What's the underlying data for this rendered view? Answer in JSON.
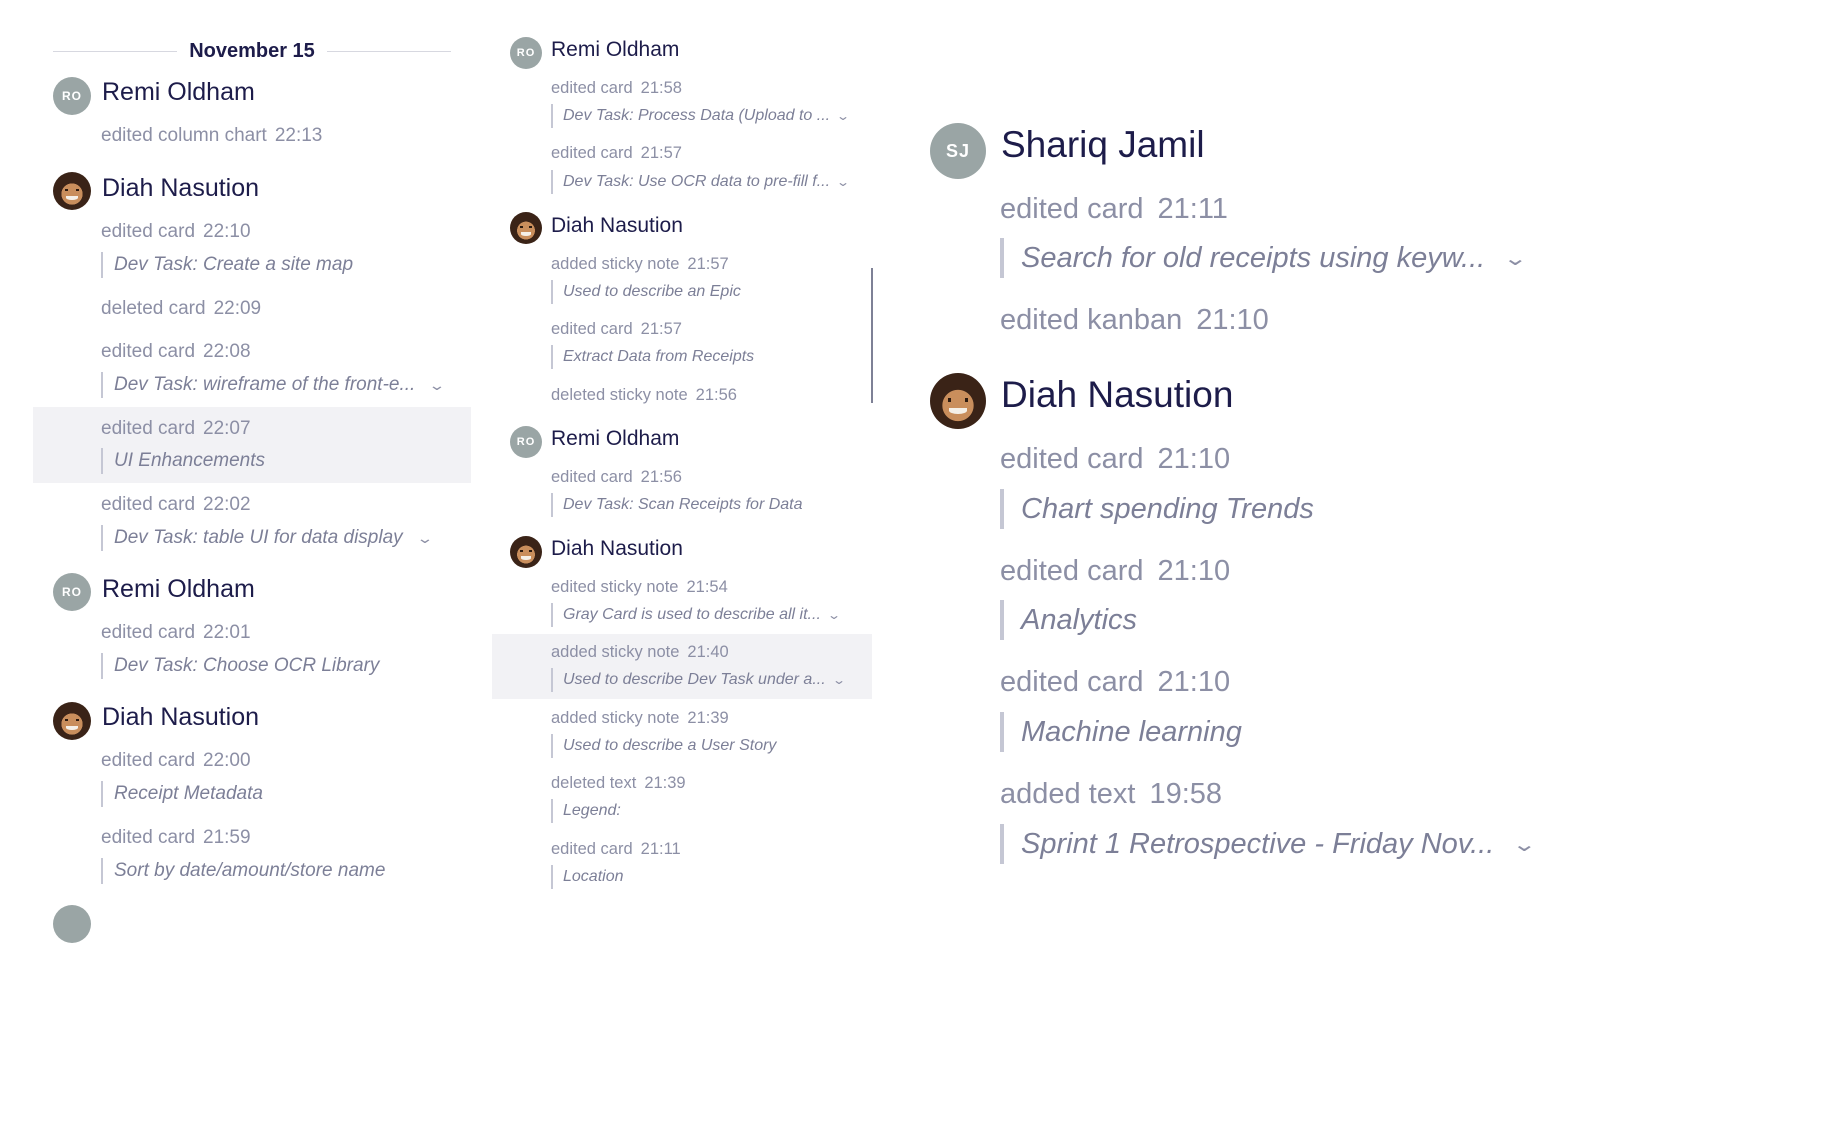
{
  "panel1": {
    "date_label": "November 15",
    "groups": [
      {
        "user": "Remi Oldham",
        "avatar": "RO",
        "entries": [
          {
            "action": "edited column chart",
            "time": "22:13"
          }
        ]
      },
      {
        "user": "Diah Nasution",
        "avatar": "photo",
        "entries": [
          {
            "action": "edited card",
            "time": "22:10",
            "quote": "Dev Task: Create a site map"
          },
          {
            "action": "deleted card",
            "time": "22:09"
          },
          {
            "action": "edited card",
            "time": "22:08",
            "quote": "Dev Task: wireframe of the front-e...",
            "expandable": true
          },
          {
            "action": "edited card",
            "time": "22:07",
            "quote": "UI Enhancements",
            "highlighted": true
          },
          {
            "action": "edited card",
            "time": "22:02",
            "quote": "Dev Task: table UI for data display",
            "expandable": true
          }
        ]
      },
      {
        "user": "Remi Oldham",
        "avatar": "RO",
        "entries": [
          {
            "action": "edited card",
            "time": "22:01",
            "quote": "Dev Task: Choose OCR Library"
          }
        ]
      },
      {
        "user": "Diah Nasution",
        "avatar": "photo",
        "entries": [
          {
            "action": "edited card",
            "time": "22:00",
            "quote": "Receipt Metadata"
          },
          {
            "action": "edited card",
            "time": "21:59",
            "quote": "Sort by date/amount/store name"
          }
        ]
      }
    ]
  },
  "panel2": {
    "groups": [
      {
        "user": "Remi Oldham",
        "avatar": "RO",
        "entries": [
          {
            "action": "edited card",
            "time": "21:58",
            "quote": "Dev Task: Process Data (Upload to ...",
            "expandable": true
          },
          {
            "action": "edited card",
            "time": "21:57",
            "quote": "Dev Task: Use OCR data to pre-fill f...",
            "expandable": true
          }
        ]
      },
      {
        "user": "Diah Nasution",
        "avatar": "photo",
        "entries": [
          {
            "action": "added sticky note",
            "time": "21:57",
            "quote": "Used to describe an Epic"
          },
          {
            "action": "edited card",
            "time": "21:57",
            "quote": "Extract Data from Receipts"
          },
          {
            "action": "deleted sticky note",
            "time": "21:56"
          }
        ]
      },
      {
        "user": "Remi Oldham",
        "avatar": "RO",
        "entries": [
          {
            "action": "edited card",
            "time": "21:56",
            "quote": "Dev Task: Scan Receipts for Data"
          }
        ]
      },
      {
        "user": "Diah Nasution",
        "avatar": "photo",
        "entries": [
          {
            "action": "edited sticky note",
            "time": "21:54",
            "quote": "Gray Card is used to describe all it...",
            "expandable": true
          },
          {
            "action": "added sticky note",
            "time": "21:40",
            "quote": "Used to describe Dev Task under a...",
            "expandable": true,
            "highlighted": true
          },
          {
            "action": "added sticky note",
            "time": "21:39",
            "quote": "Used to describe a User Story"
          },
          {
            "action": "deleted text",
            "time": "21:39",
            "quote": "Legend:"
          },
          {
            "action": "edited card",
            "time": "21:11",
            "quote": "Location"
          }
        ]
      }
    ]
  },
  "panel3": {
    "groups": [
      {
        "user": "Shariq Jamil",
        "avatar": "SJ",
        "entries": [
          {
            "action": "edited card",
            "time": "21:11",
            "quote": "Search for old receipts using keyw...",
            "expandable": true
          },
          {
            "action": "edited kanban",
            "time": "21:10"
          }
        ]
      },
      {
        "user": "Diah Nasution",
        "avatar": "photo",
        "entries": [
          {
            "action": "edited card",
            "time": "21:10",
            "quote": "Chart spending Trends"
          },
          {
            "action": "edited card",
            "time": "21:10",
            "quote": "Analytics"
          },
          {
            "action": "edited card",
            "time": "21:10",
            "quote": "Machine learning"
          },
          {
            "action": "added text",
            "time": "19:58",
            "quote": "Sprint 1 Retrospective - Friday Nov...",
            "expandable": true
          }
        ]
      }
    ]
  }
}
